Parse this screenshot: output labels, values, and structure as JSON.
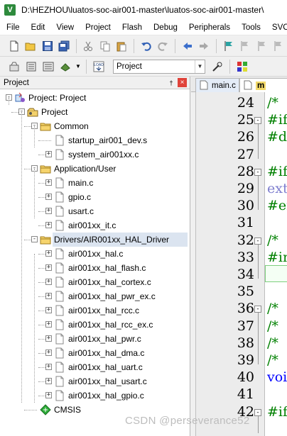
{
  "window": {
    "title": "D:\\HEZHOU\\luatos-soc-air001-master\\luatos-soc-air001-master\\"
  },
  "menu": [
    "File",
    "Edit",
    "View",
    "Project",
    "Flash",
    "Debug",
    "Peripherals",
    "Tools",
    "SVCS"
  ],
  "toolbar2": {
    "target": "Project"
  },
  "project_panel": {
    "title": "Project",
    "pin": "†",
    "close": "×",
    "tree": {
      "root": "Project: Project",
      "target": "Project",
      "groups": [
        {
          "name": "Common",
          "files": [
            "startup_air001_dev.s",
            "system_air001xx.c"
          ]
        },
        {
          "name": "Application/User",
          "files": [
            "main.c",
            "gpio.c",
            "usart.c",
            "air001xx_it.c"
          ]
        },
        {
          "name": "Drivers/AIR001xx_HAL_Driver",
          "files": [
            "air001xx_hal.c",
            "air001xx_hal_flash.c",
            "air001xx_hal_cortex.c",
            "air001xx_hal_pwr_ex.c",
            "air001xx_hal_rcc.c",
            "air001xx_hal_rcc_ex.c",
            "air001xx_hal_pwr.c",
            "air001xx_hal_dma.c",
            "air001xx_hal_uart.c",
            "air001xx_hal_usart.c",
            "air001xx_hal_gpio.c"
          ]
        },
        {
          "name": "CMSIS",
          "files": []
        }
      ]
    }
  },
  "editor": {
    "tabs": [
      "main.c",
      "m"
    ],
    "line_numbers": [
      "24",
      "25",
      "26",
      "27",
      "28",
      "29",
      "30",
      "31",
      "32",
      "33",
      "34",
      "35",
      "36",
      "37",
      "38",
      "39",
      "40",
      "41",
      "42"
    ],
    "code": [
      "/*",
      "#if",
      "#de",
      "",
      "#if",
      "ext",
      "#er",
      "",
      "/*",
      "#in",
      "",
      "",
      "/*",
      "/*",
      "/*",
      "/*",
      "voi",
      "",
      "#if"
    ]
  },
  "watermark": "CSDN @perseverance52",
  "colors": {
    "comment": "#008000",
    "preproc": "#0000ff",
    "keyword": "#0000ff",
    "extern": "#7f7fcf",
    "selection": "#dbe4f0"
  }
}
